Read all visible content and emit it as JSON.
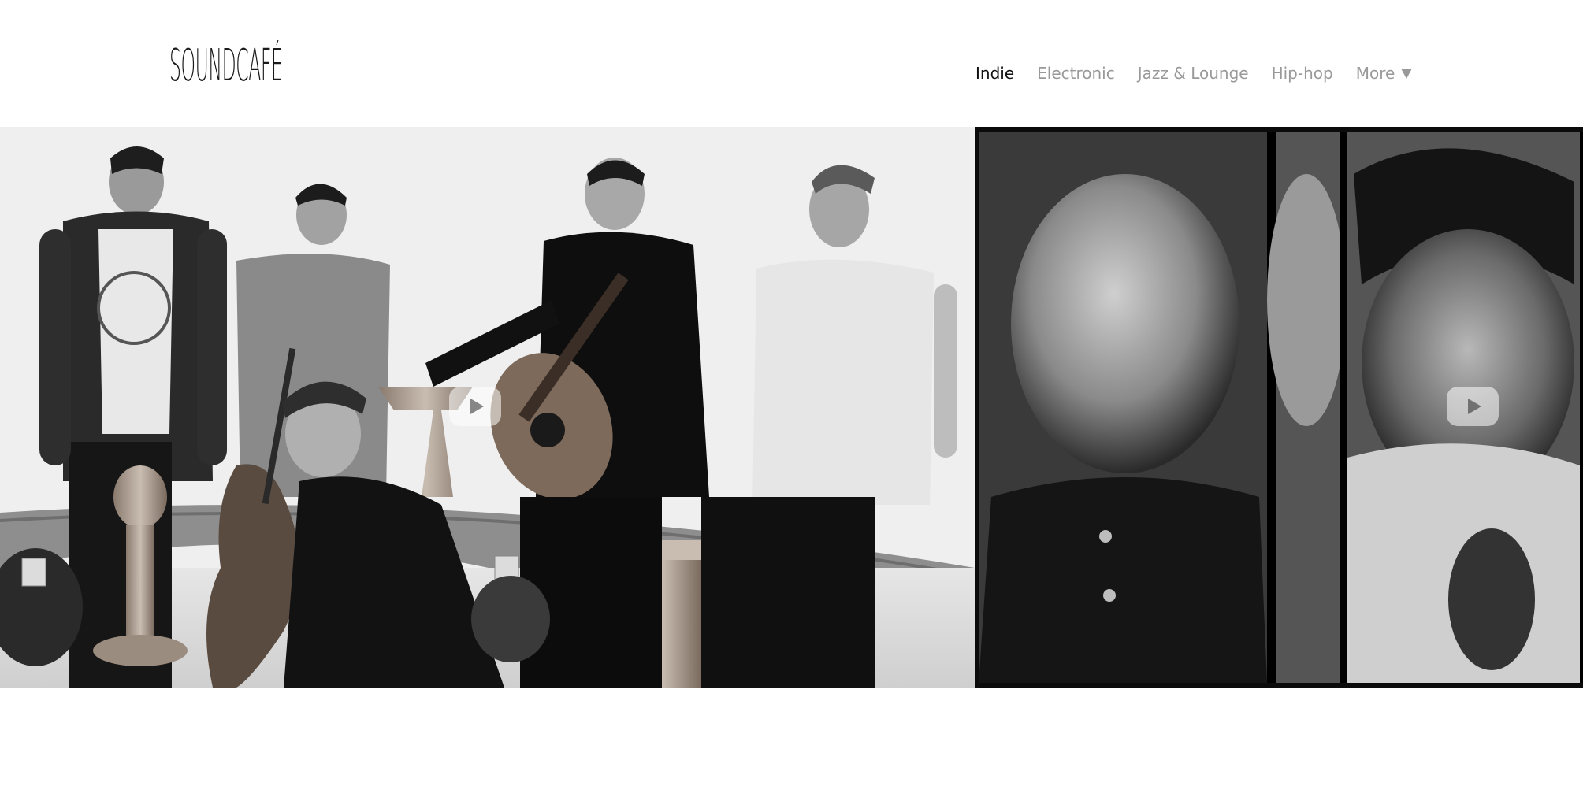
{
  "brand": {
    "logo_text": "SOUNDCAFÉ"
  },
  "nav": {
    "items": [
      {
        "label": "Indie",
        "active": true
      },
      {
        "label": "Electronic",
        "active": false
      },
      {
        "label": "Jazz & Lounge",
        "active": false
      },
      {
        "label": "Hip-hop",
        "active": false
      }
    ],
    "more_label": "More",
    "more_icon": "caret-down-icon"
  },
  "slides": [
    {
      "image": "band-group-photo",
      "play_icon": "play-icon"
    },
    {
      "image": "musician-portrait-collage",
      "play_icon": "play-icon"
    }
  ],
  "colors": {
    "nav_active": "#111111",
    "nav_inactive": "#999999",
    "background": "#ffffff"
  }
}
